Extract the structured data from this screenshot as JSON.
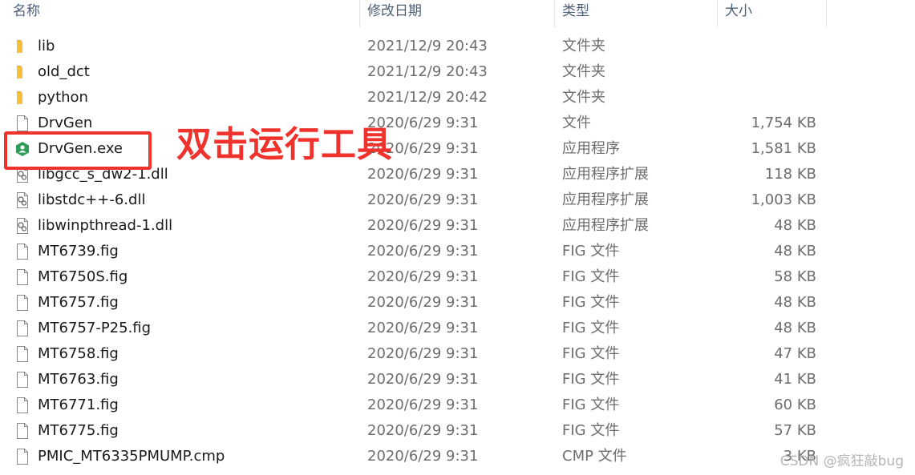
{
  "columns": {
    "name": "名称",
    "date": "修改日期",
    "type": "类型",
    "size": "大小"
  },
  "files": [
    {
      "name": "lib",
      "date": "2021/12/9 20:43",
      "type": "文件夹",
      "size": "",
      "icon": "folder-icon"
    },
    {
      "name": "old_dct",
      "date": "2021/12/9 20:43",
      "type": "文件夹",
      "size": "",
      "icon": "folder-icon"
    },
    {
      "name": "python",
      "date": "2021/12/9 20:42",
      "type": "文件夹",
      "size": "",
      "icon": "folder-icon"
    },
    {
      "name": "DrvGen",
      "date": "2020/6/29 9:31",
      "type": "文件",
      "size": "1,754 KB",
      "icon": "file-icon"
    },
    {
      "name": "DrvGen.exe",
      "date": "2020/6/29 9:31",
      "type": "应用程序",
      "size": "1,581 KB",
      "icon": "app-icon"
    },
    {
      "name": "libgcc_s_dw2-1.dll",
      "date": "2020/6/29 9:31",
      "type": "应用程序扩展",
      "size": "118 KB",
      "icon": "dll-icon"
    },
    {
      "name": "libstdc++-6.dll",
      "date": "2020/6/29 9:31",
      "type": "应用程序扩展",
      "size": "1,003 KB",
      "icon": "dll-icon"
    },
    {
      "name": "libwinpthread-1.dll",
      "date": "2020/6/29 9:31",
      "type": "应用程序扩展",
      "size": "48 KB",
      "icon": "dll-icon"
    },
    {
      "name": "MT6739.fig",
      "date": "2020/6/29 9:31",
      "type": "FIG 文件",
      "size": "48 KB",
      "icon": "file-icon"
    },
    {
      "name": "MT6750S.fig",
      "date": "2020/6/29 9:31",
      "type": "FIG 文件",
      "size": "58 KB",
      "icon": "file-icon"
    },
    {
      "name": "MT6757.fig",
      "date": "2020/6/29 9:31",
      "type": "FIG 文件",
      "size": "48 KB",
      "icon": "file-icon"
    },
    {
      "name": "MT6757-P25.fig",
      "date": "2020/6/29 9:31",
      "type": "FIG 文件",
      "size": "48 KB",
      "icon": "file-icon"
    },
    {
      "name": "MT6758.fig",
      "date": "2020/6/29 9:31",
      "type": "FIG 文件",
      "size": "47 KB",
      "icon": "file-icon"
    },
    {
      "name": "MT6763.fig",
      "date": "2020/6/29 9:31",
      "type": "FIG 文件",
      "size": "41 KB",
      "icon": "file-icon"
    },
    {
      "name": "MT6771.fig",
      "date": "2020/6/29 9:31",
      "type": "FIG 文件",
      "size": "60 KB",
      "icon": "file-icon"
    },
    {
      "name": "MT6775.fig",
      "date": "2020/6/29 9:31",
      "type": "FIG 文件",
      "size": "57 KB",
      "icon": "file-icon"
    },
    {
      "name": "PMIC_MT6335PMUMP.cmp",
      "date": "2020/6/29 9:31",
      "type": "CMP 文件",
      "size": "3 KB",
      "icon": "file-icon"
    }
  ],
  "annotation": "双击运行工具",
  "watermark": "CSDN @疯狂敲bug",
  "colors": {
    "annotation": "#f0322d",
    "folder": "#f5c13b",
    "app": "#2e9d5a"
  }
}
